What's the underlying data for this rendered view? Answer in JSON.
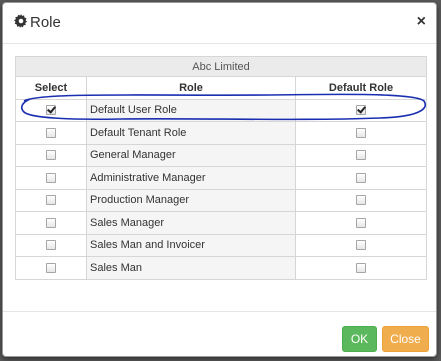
{
  "dialog": {
    "title": "Role",
    "close_label": "×"
  },
  "table": {
    "company": "Abc Limited",
    "columns": [
      "Select",
      "Role",
      "Default Role"
    ],
    "rows": [
      {
        "role": "Default User Role",
        "selected": true,
        "default": true
      },
      {
        "role": "Default Tenant Role",
        "selected": false,
        "default": false
      },
      {
        "role": "General Manager",
        "selected": false,
        "default": false
      },
      {
        "role": "Administrative Manager",
        "selected": false,
        "default": false
      },
      {
        "role": "Production Manager",
        "selected": false,
        "default": false
      },
      {
        "role": "Sales Manager",
        "selected": false,
        "default": false
      },
      {
        "role": "Sales Man and Invoicer",
        "selected": false,
        "default": false
      },
      {
        "role": "Sales Man",
        "selected": false,
        "default": false
      }
    ]
  },
  "footer": {
    "ok_label": "OK",
    "close_label": "Close"
  },
  "colors": {
    "ok": "#5cb85c",
    "close": "#f0ad4e",
    "annotation": "#1a2fb0"
  },
  "icons": {
    "title_icon": "gear-icon"
  }
}
